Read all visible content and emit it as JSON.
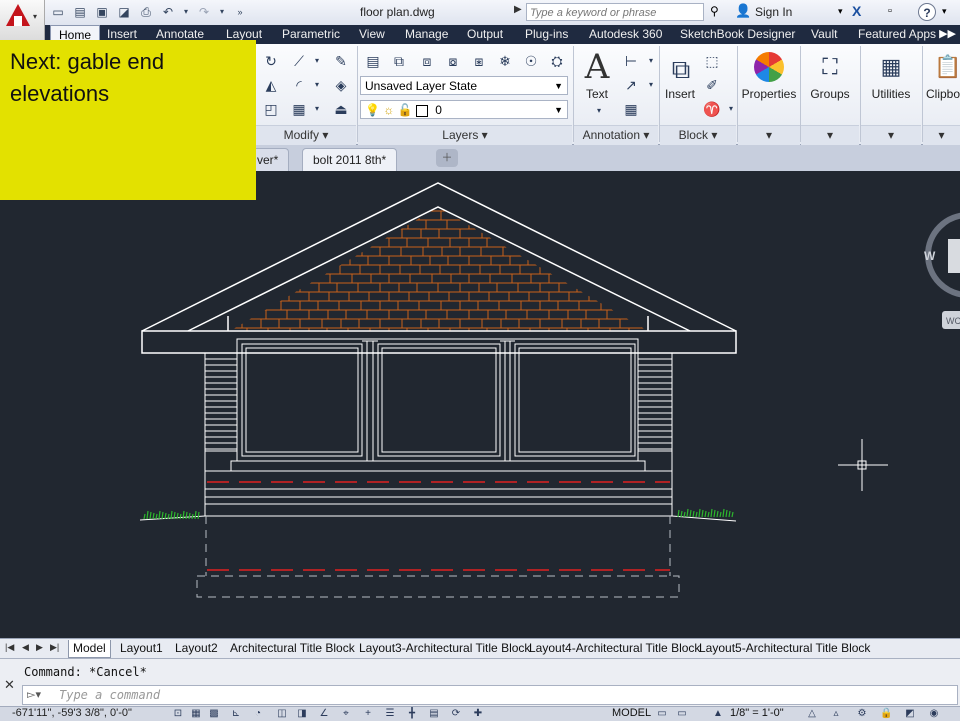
{
  "title_bar": {
    "file_name": "floor plan.dwg",
    "search_placeholder": "Type a keyword or phrase",
    "sign_in": "Sign In"
  },
  "ribbon_tabs": [
    "Home",
    "Insert",
    "Annotate",
    "Layout",
    "Parametric",
    "View",
    "Manage",
    "Output",
    "Plug-ins",
    "Autodesk 360",
    "SketchBook Designer",
    "Vault",
    "Featured Apps"
  ],
  "ribbon": {
    "layer_state": "Unsaved Layer State",
    "layer_current": "0",
    "text_label": "Text",
    "insert_label": "Insert",
    "properties_label": "Properties",
    "groups_label": "Groups",
    "utilities_label": "Utilities",
    "clipboard_label": "Clipbo",
    "panels": {
      "modify": "Modify",
      "layers": "Layers",
      "annotation": "Annotation",
      "block": "Block"
    }
  },
  "note": {
    "text": "Next: gable end elevations"
  },
  "file_tabs": [
    "ver*",
    "bolt 2011 8th*"
  ],
  "viewcube": {
    "west_label": "W",
    "wcs_label": "WC"
  },
  "layout_tabs": [
    "Model",
    "Layout1",
    "Layout2",
    "Architectural Title Block",
    "Layout3-Architectural Title Block",
    "Layout4-Architectural Title Block",
    "Layout5-Architectural Title Block"
  ],
  "command": {
    "history": "Command: *Cancel*",
    "placeholder": "Type a command"
  },
  "status": {
    "coordinates": "-671'11\",  -59'3 3/8\",  0'-0\"",
    "model": "MODEL",
    "scale": "1/8\" = 1'-0\""
  },
  "colors": {
    "canvas": "#212730",
    "note_bg": "#e3e100",
    "shingles": "#c9621a",
    "grass": "#2db52d",
    "dash_red": "#e02020"
  }
}
